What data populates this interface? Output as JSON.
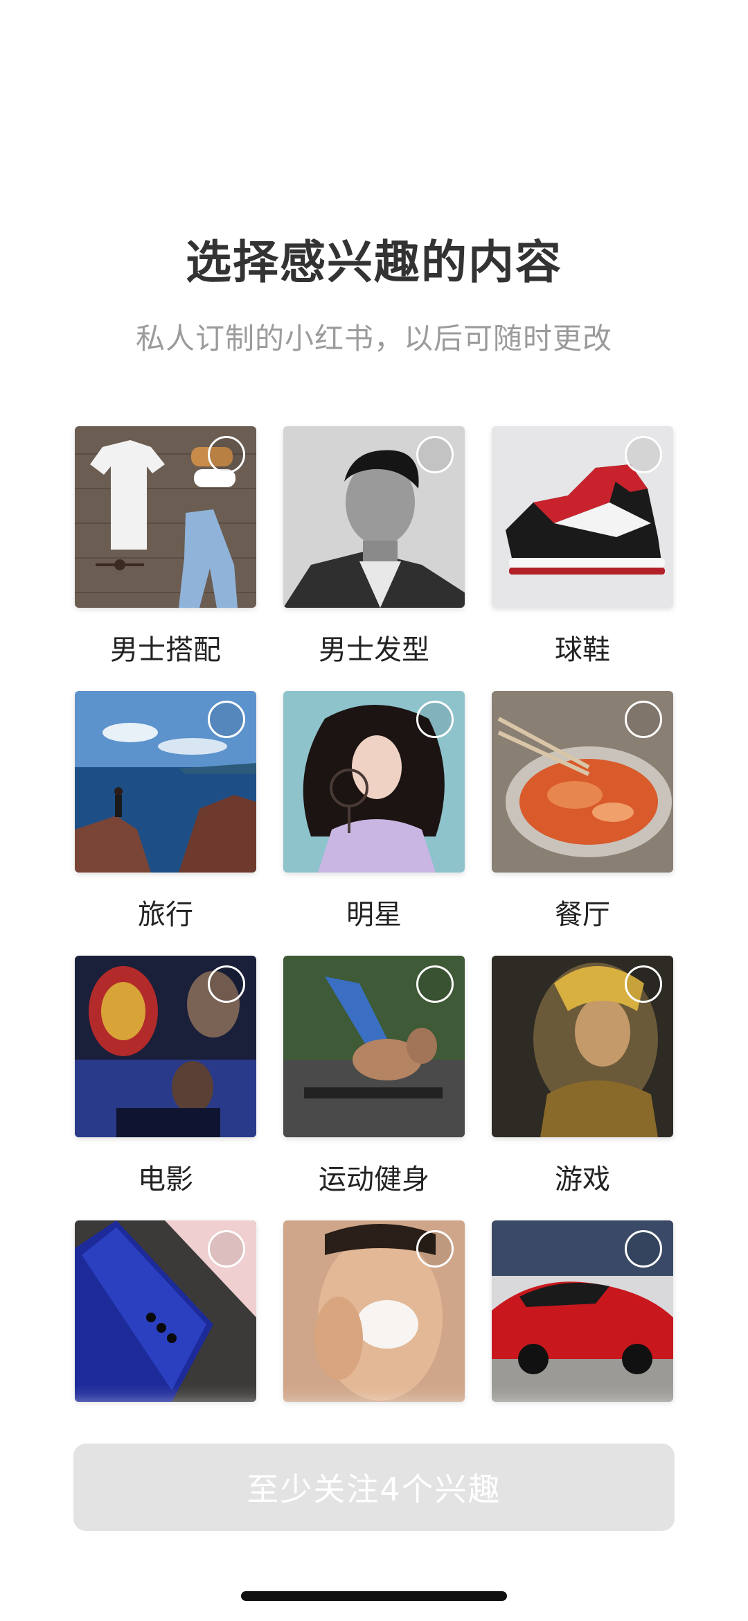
{
  "header": {
    "title": "选择感兴趣的内容",
    "subtitle": "私人订制的小红书，以后可随时更改"
  },
  "interests": [
    {
      "label": "男士搭配",
      "image": "outfit-flatlay-image",
      "selected": false
    },
    {
      "label": "男士发型",
      "image": "man-hairstyle-portrait-image",
      "selected": false
    },
    {
      "label": "球鞋",
      "image": "sneakers-image",
      "selected": false
    },
    {
      "label": "旅行",
      "image": "coastal-travel-image",
      "selected": false
    },
    {
      "label": "明星",
      "image": "celebrity-portrait-image",
      "selected": false
    },
    {
      "label": "餐厅",
      "image": "hotpot-food-image",
      "selected": false
    },
    {
      "label": "电影",
      "image": "movie-poster-image",
      "selected": false
    },
    {
      "label": "运动健身",
      "image": "fitness-workout-image",
      "selected": false
    },
    {
      "label": "游戏",
      "image": "game-character-image",
      "selected": false
    },
    {
      "label": "",
      "image": "smartphone-image",
      "selected": false
    },
    {
      "label": "",
      "image": "skincare-face-image",
      "selected": false
    },
    {
      "label": "",
      "image": "red-sports-car-image",
      "selected": false
    }
  ],
  "footer": {
    "button_label": "至少关注4个兴趣",
    "button_enabled": false
  },
  "colors": {
    "title": "#333333",
    "subtitle": "#9b9b9b",
    "button_disabled_bg": "#e3e3e3",
    "button_text": "#ffffff"
  }
}
